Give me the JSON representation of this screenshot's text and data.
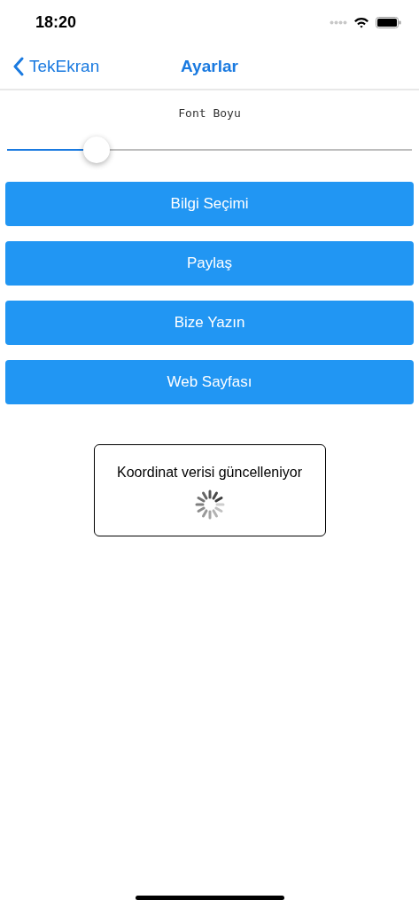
{
  "status_bar": {
    "time": "18:20"
  },
  "nav_bar": {
    "back": "TekEkran",
    "title": "Ayarlar"
  },
  "font_size": {
    "label": "Font Boyu",
    "level": 0.22
  },
  "buttons": [
    "Bilgi Seçimi",
    "Paylaş",
    "Bize Yazın",
    "Web Sayfası"
  ],
  "dialog": {
    "message": "Koordinat verisi güncelleniyor"
  }
}
